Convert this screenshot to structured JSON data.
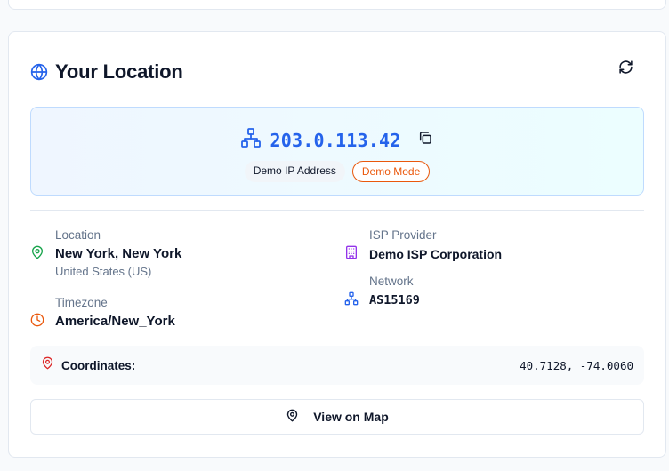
{
  "card": {
    "title": "Your Location",
    "icons": {
      "title": "globe-icon",
      "refresh": "refresh-icon"
    }
  },
  "ip": {
    "address": "203.0.113.42",
    "badge_type": "Demo IP Address",
    "badge_mode": "Demo Mode",
    "icons": {
      "network": "network-icon",
      "copy": "copy-icon"
    }
  },
  "location": {
    "label": "Location",
    "value": "New York, New York",
    "sub": "United States (US)",
    "icon": "map-pin-icon"
  },
  "timezone": {
    "label": "Timezone",
    "value": "America/New_York",
    "icon": "clock-icon"
  },
  "isp": {
    "label": "ISP Provider",
    "value": "Demo ISP Corporation",
    "icon": "building-icon"
  },
  "network": {
    "label": "Network",
    "value": "AS15169",
    "icon": "network-icon"
  },
  "coordinates": {
    "label": "Coordinates:",
    "value": "40.7128, -74.0060",
    "icon": "map-pin-icon"
  },
  "map_button": {
    "label": "View on Map",
    "icon": "map-pin-icon"
  },
  "colors": {
    "accent_blue": "#2563eb",
    "orange": "#ea580c",
    "green": "#16a34a",
    "purple": "#9333ea",
    "red": "#dc2626"
  }
}
